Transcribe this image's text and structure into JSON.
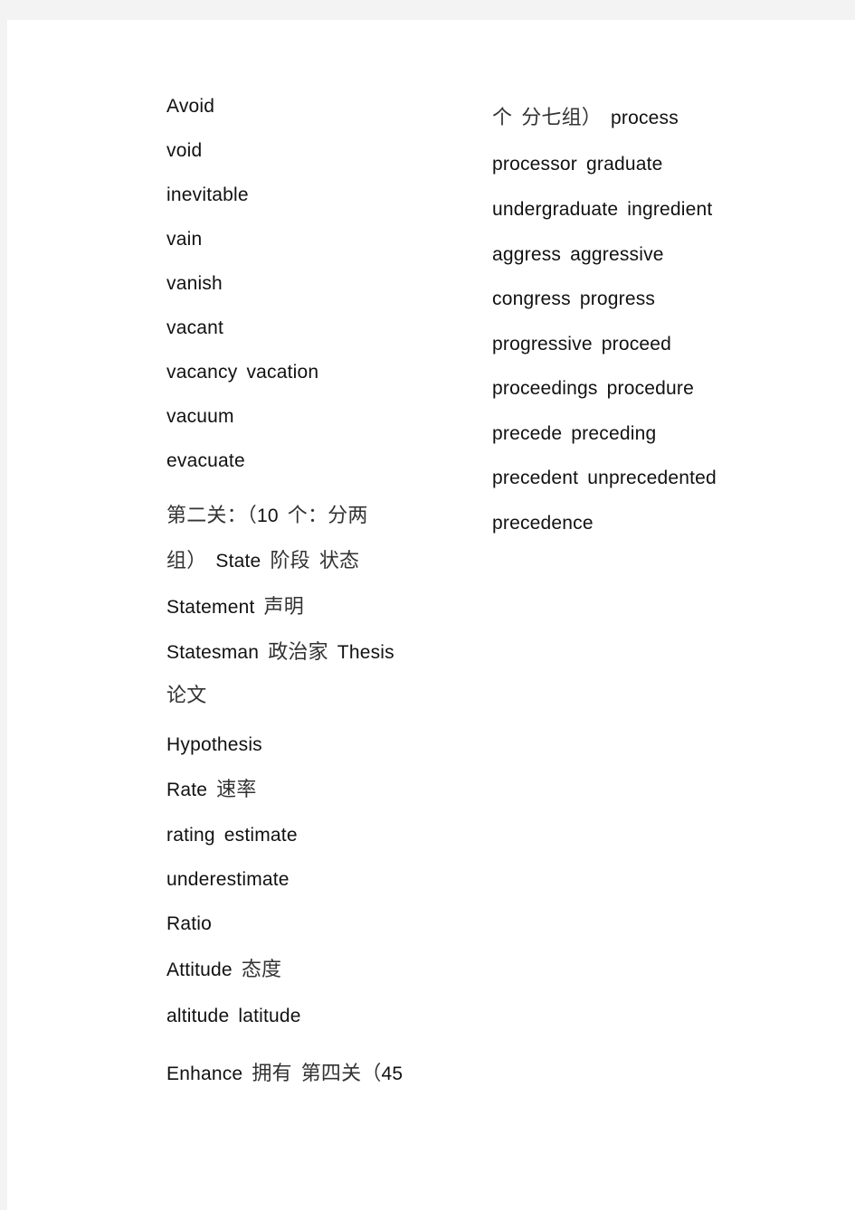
{
  "document": {
    "left_column": [
      {
        "parts": [
          {
            "t": "Avoid"
          }
        ]
      },
      {
        "parts": [
          {
            "t": "void"
          }
        ]
      },
      {
        "parts": [
          {
            "t": "inevitable"
          }
        ]
      },
      {
        "parts": [
          {
            "t": "vain"
          }
        ]
      },
      {
        "parts": [
          {
            "t": "vanish"
          }
        ]
      },
      {
        "parts": [
          {
            "t": "vacant"
          }
        ]
      },
      {
        "parts": [
          {
            "t": "vacancy"
          },
          {
            "t": "vacation"
          }
        ]
      },
      {
        "parts": [
          {
            "t": "vacuum"
          }
        ]
      },
      {
        "parts": [
          {
            "t": "evacuate"
          }
        ]
      },
      {
        "parts": [
          {
            "t": "第二关：（",
            "cjk": true
          },
          {
            "t": "10",
            "tight": true
          },
          {
            "t": "个：分两",
            "cjk": true
          }
        ]
      },
      {
        "parts": [
          {
            "t": "组）",
            "cjk": true
          },
          {
            "t": "State"
          },
          {
            "t": "阶段",
            "cjk": true
          },
          {
            "t": "状态",
            "cjk": true
          }
        ]
      },
      {
        "parts": [
          {
            "t": "Statement"
          },
          {
            "t": "声明",
            "cjk": true
          }
        ]
      },
      {
        "parts": [
          {
            "t": "Statesman"
          },
          {
            "t": "政治家",
            "cjk": true
          },
          {
            "t": "Thesis"
          }
        ]
      },
      {
        "parts": [
          {
            "t": "论文",
            "cjk": true
          }
        ]
      },
      {
        "parts": [
          {
            "t": "Hypothesis"
          }
        ]
      },
      {
        "parts": [
          {
            "t": "Rate"
          },
          {
            "t": "速率",
            "cjk": true
          }
        ]
      },
      {
        "parts": [
          {
            "t": "rating"
          },
          {
            "t": "estimate"
          }
        ]
      },
      {
        "parts": [
          {
            "t": "underestimate"
          }
        ]
      },
      {
        "parts": [
          {
            "t": "Ratio"
          }
        ]
      },
      {
        "parts": [
          {
            "t": "Attitude"
          },
          {
            "t": "态度",
            "cjk": true
          }
        ]
      },
      {
        "parts": [
          {
            "t": "altitude"
          },
          {
            "t": "latitude"
          }
        ]
      },
      {
        "parts": [
          {
            "t": "Enhance"
          },
          {
            "t": "拥有",
            "cjk": true
          },
          {
            "t": "第四关（",
            "cjk": true
          },
          {
            "t": "45",
            "tight": true
          }
        ]
      }
    ],
    "right_column": [
      {
        "parts": [
          {
            "t": "个",
            "cjk": true
          },
          {
            "t": "分七组）",
            "cjk": true
          },
          {
            "t": "process"
          }
        ]
      },
      {
        "parts": [
          {
            "t": "processor"
          },
          {
            "t": "graduate"
          }
        ]
      },
      {
        "parts": [
          {
            "t": "undergraduate"
          },
          {
            "t": "ingredient"
          }
        ]
      },
      {
        "parts": [
          {
            "t": "aggress"
          },
          {
            "t": "aggressive"
          }
        ]
      },
      {
        "parts": [
          {
            "t": "congress"
          },
          {
            "t": "progress"
          }
        ]
      },
      {
        "parts": [
          {
            "t": "progressive"
          },
          {
            "t": "proceed"
          }
        ]
      },
      {
        "parts": [
          {
            "t": "proceedings"
          },
          {
            "t": "procedure"
          }
        ]
      },
      {
        "parts": [
          {
            "t": "precede"
          },
          {
            "t": "preceding"
          }
        ]
      },
      {
        "parts": [
          {
            "t": "precedent"
          },
          {
            "t": "unprecedented"
          }
        ]
      },
      {
        "parts": [
          {
            "t": "precedence"
          }
        ]
      }
    ]
  }
}
